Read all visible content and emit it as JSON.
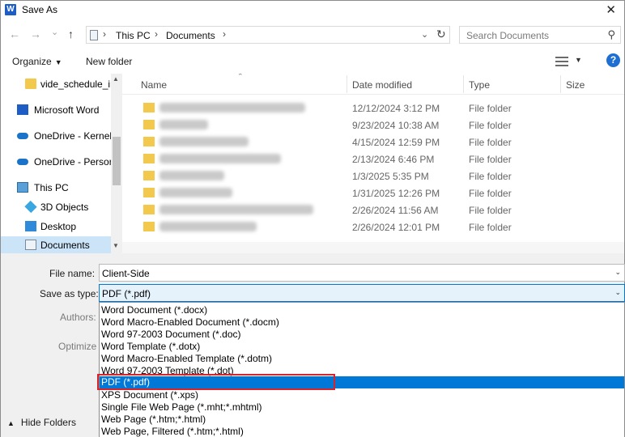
{
  "window": {
    "title": "Save As",
    "app_icon_letter": "W",
    "close_glyph": "✕"
  },
  "nav": {
    "back": "←",
    "forward": "→",
    "recent": "⌄",
    "up": "↑",
    "breadcrumb": [
      "This PC",
      "Documents"
    ],
    "refresh": "↻",
    "search_placeholder": "Search Documents"
  },
  "toolbar": {
    "organize": "Organize",
    "new_folder": "New folder",
    "help": "?"
  },
  "sidebar": {
    "items": [
      {
        "label": "vide_schedule_ir",
        "icon": "folder-icon"
      },
      {
        "label": "Microsoft Word",
        "icon": "word-icon"
      },
      {
        "label": "OneDrive - Kernel",
        "icon": "cloud-icon"
      },
      {
        "label": "OneDrive - Persor",
        "icon": "cloud-icon"
      },
      {
        "label": "This PC",
        "icon": "computer-icon"
      },
      {
        "label": "3D Objects",
        "icon": "cube-icon"
      },
      {
        "label": "Desktop",
        "icon": "desktop-icon"
      },
      {
        "label": "Documents",
        "icon": "documents-icon",
        "selected": true
      }
    ]
  },
  "files": {
    "columns": [
      "Name",
      "Date modified",
      "Type",
      "Size"
    ],
    "rows": [
      {
        "date": "12/12/2024 3:12 PM",
        "type": "File folder"
      },
      {
        "date": "9/23/2024 10:38 AM",
        "type": "File folder"
      },
      {
        "date": "4/15/2024 12:59 PM",
        "type": "File folder"
      },
      {
        "date": "2/13/2024 6:46 PM",
        "type": "File folder"
      },
      {
        "date": "1/3/2025 5:35 PM",
        "type": "File folder"
      },
      {
        "date": "1/31/2025 12:26 PM",
        "type": "File folder"
      },
      {
        "date": "2/26/2024 11:56 AM",
        "type": "File folder"
      },
      {
        "date": "2/26/2024 12:01 PM",
        "type": "File folder"
      }
    ]
  },
  "form": {
    "file_name_label": "File name:",
    "file_name_value": "Client-Side",
    "save_type_label": "Save as type:",
    "save_type_value": "PDF (*.pdf)",
    "authors_label": "Authors:",
    "optimize_label": "Optimize",
    "hide_folders": "Hide Folders",
    "type_options": [
      "Word Document (*.docx)",
      "Word Macro-Enabled Document (*.docm)",
      "Word 97-2003 Document (*.doc)",
      "Word Template (*.dotx)",
      "Word Macro-Enabled Template (*.dotm)",
      "Word 97-2003 Template (*.dot)",
      "PDF (*.pdf)",
      "XPS Document (*.xps)",
      "Single File Web Page (*.mht;*.mhtml)",
      "Web Page (*.htm;*.html)",
      "Web Page, Filtered (*.htm;*.html)"
    ],
    "selected_option_index": 6
  },
  "colors": {
    "accent": "#0078d7",
    "highlight_box": "#d9232a",
    "selected_nav": "#cce4f7"
  }
}
